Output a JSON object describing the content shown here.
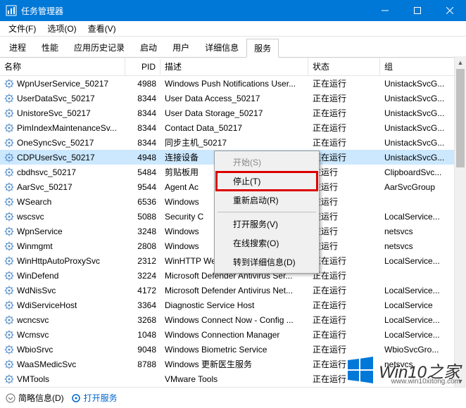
{
  "window": {
    "title": "任务管理器",
    "minimize": "—",
    "maximize": "☐",
    "close": "✕"
  },
  "menu": {
    "file": "文件(F)",
    "options": "选项(O)",
    "view": "查看(V)"
  },
  "tabs": {
    "processes": "进程",
    "performance": "性能",
    "apphistory": "应用历史记录",
    "startup": "启动",
    "users": "用户",
    "details": "详细信息",
    "services": "服务"
  },
  "headers": {
    "name": "名称",
    "pid": "PID",
    "desc": "描述",
    "status": "状态",
    "group": "组"
  },
  "rows": [
    {
      "name": "WpnUserService_50217",
      "pid": "4988",
      "desc": "Windows Push Notifications User...",
      "status": "正在运行",
      "group": "UnistackSvcG..."
    },
    {
      "name": "UserDataSvc_50217",
      "pid": "8344",
      "desc": "User Data Access_50217",
      "status": "正在运行",
      "group": "UnistackSvcG..."
    },
    {
      "name": "UnistoreSvc_50217",
      "pid": "8344",
      "desc": "User Data Storage_50217",
      "status": "正在运行",
      "group": "UnistackSvcG..."
    },
    {
      "name": "PimIndexMaintenanceSv...",
      "pid": "8344",
      "desc": "Contact Data_50217",
      "status": "正在运行",
      "group": "UnistackSvcG..."
    },
    {
      "name": "OneSyncSvc_50217",
      "pid": "8344",
      "desc": "同步主机_50217",
      "status": "正在运行",
      "group": "UnistackSvcG..."
    },
    {
      "name": "CDPUserSvc_50217",
      "pid": "4948",
      "desc": "连接设备",
      "status": "正在运行",
      "group": "UnistackSvcG...",
      "selected": true
    },
    {
      "name": "cbdhsvc_50217",
      "pid": "5484",
      "desc": "剪贴板用",
      "status": "在运行",
      "group": "ClipboardSvc..."
    },
    {
      "name": "AarSvc_50217",
      "pid": "9544",
      "desc": "Agent Ac",
      "status": "在运行",
      "group": "AarSvcGroup"
    },
    {
      "name": "WSearch",
      "pid": "6536",
      "desc": "Windows",
      "status": "在运行",
      "group": ""
    },
    {
      "name": "wscsvc",
      "pid": "5088",
      "desc": "Security C",
      "status": "在运行",
      "group": "LocalService..."
    },
    {
      "name": "WpnService",
      "pid": "3248",
      "desc": "Windows",
      "status": "在运行",
      "group": "netsvcs"
    },
    {
      "name": "Winmgmt",
      "pid": "2808",
      "desc": "Windows",
      "status": "在运行",
      "group": "netsvcs"
    },
    {
      "name": "WinHttpAutoProxySvc",
      "pid": "2312",
      "desc": "WinHTTP Web Proxy Auto-Discov...",
      "status": "正在运行",
      "group": "LocalService..."
    },
    {
      "name": "WinDefend",
      "pid": "3224",
      "desc": "Microsoft Defender Antivirus Ser...",
      "status": "正在运行",
      "group": ""
    },
    {
      "name": "WdNisSvc",
      "pid": "4172",
      "desc": "Microsoft Defender Antivirus Net...",
      "status": "正在运行",
      "group": "LocalService..."
    },
    {
      "name": "WdiServiceHost",
      "pid": "3364",
      "desc": "Diagnostic Service Host",
      "status": "正在运行",
      "group": "LocalService"
    },
    {
      "name": "wcncsvc",
      "pid": "3268",
      "desc": "Windows Connect Now - Config ...",
      "status": "正在运行",
      "group": "LocalService..."
    },
    {
      "name": "Wcmsvc",
      "pid": "1048",
      "desc": "Windows Connection Manager",
      "status": "正在运行",
      "group": "LocalService..."
    },
    {
      "name": "WbioSrvc",
      "pid": "9048",
      "desc": "Windows Biometric Service",
      "status": "正在运行",
      "group": "WbioSvcGro..."
    },
    {
      "name": "WaaSMedicSvc",
      "pid": "8788",
      "desc": "Windows 更新医生服务",
      "status": "正在运行",
      "group": "netsvcs"
    },
    {
      "name": "VMTools",
      "pid": "",
      "desc": "VMware Tools",
      "status": "正在运行",
      "group": ""
    }
  ],
  "contextmenu": {
    "start": "开始(S)",
    "stop": "停止(T)",
    "restart": "重新启动(R)",
    "open": "打开服务(V)",
    "search": "在线搜索(O)",
    "details": "转到详细信息(D)"
  },
  "statusbar": {
    "brief": "简略信息(D)",
    "openservices": "打开服务"
  },
  "watermark": {
    "text": "Win10之家",
    "url": "www.win10xitong.com"
  }
}
